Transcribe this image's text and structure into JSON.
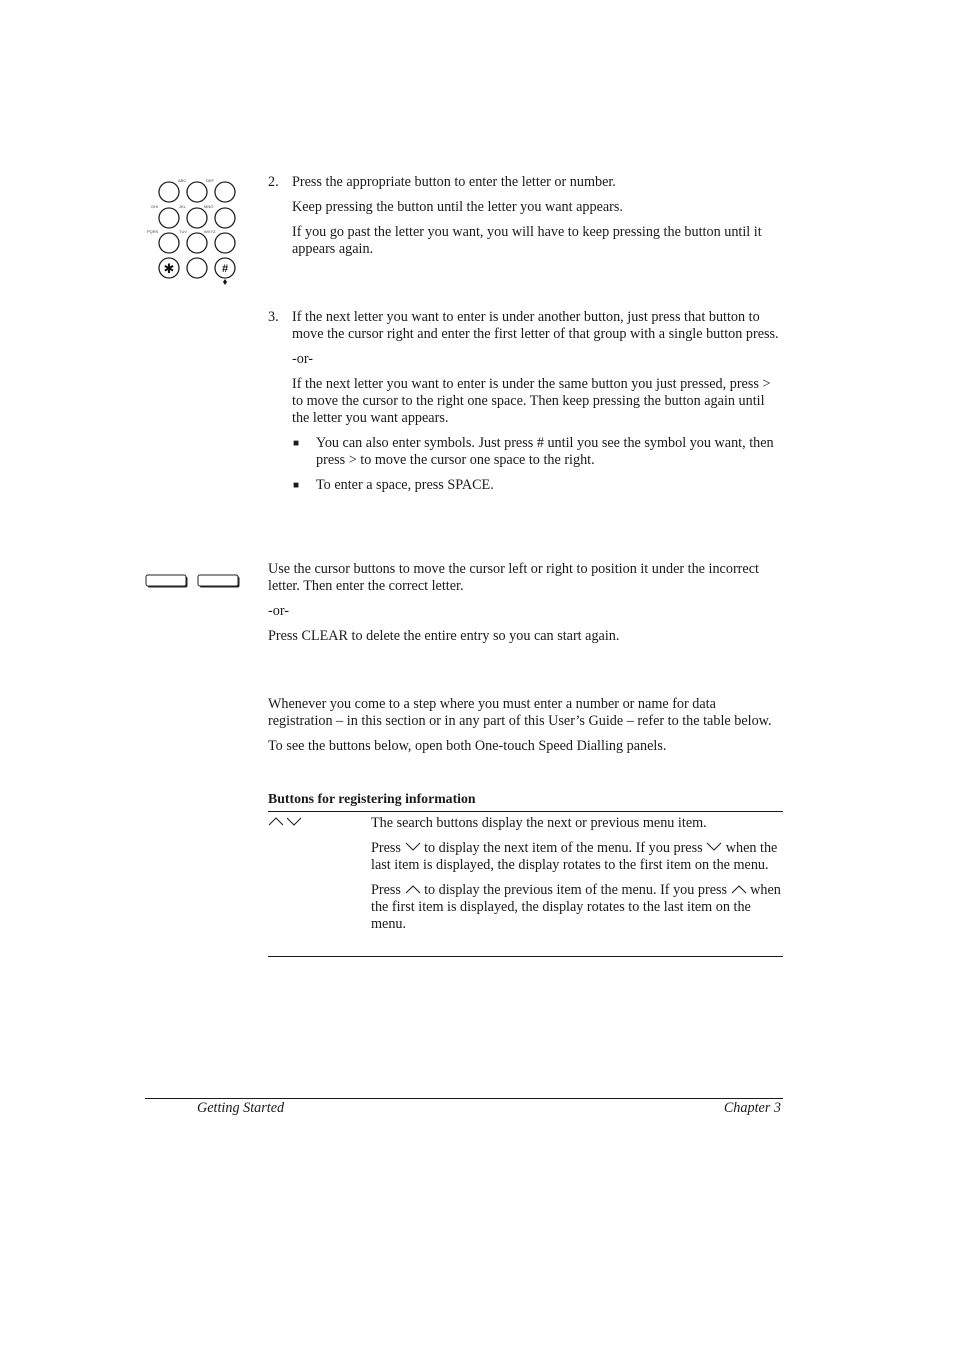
{
  "keypad": {
    "labels": [
      "ABC",
      "DEF",
      "GHI",
      "JKL",
      "MNO",
      "PQRS",
      "TUV",
      "WXYZ"
    ],
    "star": "✱",
    "hash": "#"
  },
  "step2": {
    "number": "2.",
    "lines": [
      "Press the appropriate button to enter the letter or number.",
      "Keep pressing the button until the letter you want appears.",
      "If you go past the letter you want, you will have to keep pressing the button until it appears again."
    ]
  },
  "step3": {
    "number": "3.",
    "para1": "If the next letter you want to enter is under another button, just press that button to move the cursor right and enter the first letter of that group with a single button press.",
    "or": "-or-",
    "para2": "If the next letter you want to enter is under the same button you just pressed, press > to move the cursor to the right one space. Then keep pressing the button again until the letter you want appears.",
    "bullets": [
      "You can also enter symbols. Just press # until you see the symbol you want, then press > to move the cursor one space to the right.",
      "To enter a space, press SPACE."
    ],
    "bullet_mark": "■"
  },
  "correction": {
    "para1": "Use the cursor buttons to move the cursor left or right to position it under the incorrect letter. Then enter the correct letter.",
    "or": "-or-",
    "para2": "Press CLEAR to delete the entire entry so you can start again."
  },
  "registration": {
    "para1": "Whenever you come to a step where you must enter a number or name for data registration – in this section or in any part of this User’s Guide – refer to the table below.",
    "para2": "To see the buttons below, open both One-touch Speed Dialling panels.",
    "table_title": "Buttons for registering information",
    "row": {
      "button_icons": [
        "up-chevron",
        "down-chevron"
      ],
      "desc1": "The search buttons display the next or previous menu item.",
      "desc2_a": "Press ",
      "desc2_b": " to display the next item of the menu. If you press ",
      "desc2_c": " when the last item is displayed, the display rotates to the first item on the menu.",
      "desc3_a": "Press ",
      "desc3_b": " to display the previous item of the menu. If you press ",
      "desc3_c": " when the first item is displayed, the display rotates to the last item on the menu."
    }
  },
  "footer": {
    "left": "Getting Started",
    "right": "Chapter 3"
  }
}
